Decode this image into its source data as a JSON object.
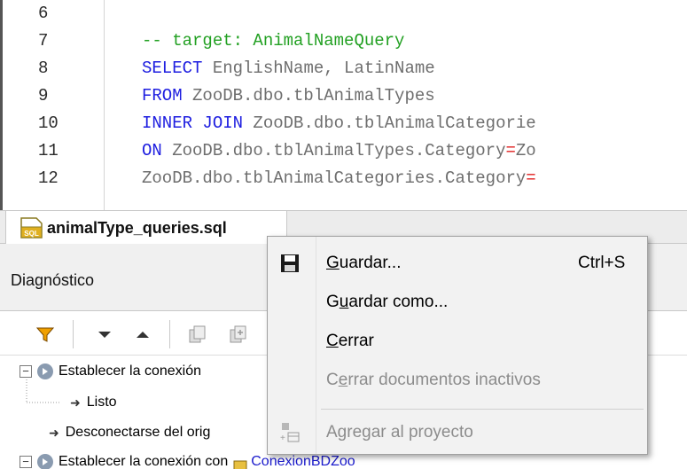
{
  "editor": {
    "lines": [
      {
        "num": "6",
        "tokens": []
      },
      {
        "num": "7",
        "tokens": [
          {
            "t": "-- target: AnimalNameQuery",
            "c": "cm"
          }
        ]
      },
      {
        "num": "8",
        "tokens": [
          {
            "t": "SELECT",
            "c": "kw"
          },
          {
            "t": " EnglishName, LatinName",
            "c": "id"
          }
        ]
      },
      {
        "num": "9",
        "tokens": [
          {
            "t": "FROM",
            "c": "kw"
          },
          {
            "t": " ZooDB.dbo.tblAnimalTypes",
            "c": "id"
          }
        ]
      },
      {
        "num": "10",
        "tokens": [
          {
            "t": "INNER JOIN",
            "c": "kw"
          },
          {
            "t": " ZooDB.dbo.tblAnimalCategorie",
            "c": "id"
          }
        ]
      },
      {
        "num": "11",
        "tokens": [
          {
            "t": "ON",
            "c": "kw"
          },
          {
            "t": " ZooDB.dbo.tblAnimalTypes.Category",
            "c": "id"
          },
          {
            "t": "=",
            "c": "op"
          },
          {
            "t": "Zo",
            "c": "id"
          }
        ]
      },
      {
        "num": "12",
        "tokens": [
          {
            "t": "ZooDB.dbo.tblAnimalCategories.Category",
            "c": "id"
          },
          {
            "t": "=",
            "c": "op"
          }
        ]
      }
    ]
  },
  "tab": {
    "filename": "animalType_queries.sql",
    "icon": "sql-file-icon"
  },
  "diagnostics": {
    "title": "Diagnóstico",
    "rows": {
      "r1": "Establecer la conexión",
      "r2": "Listo",
      "r3": "Desconectarse del orig",
      "r4_prefix": "Establecer la conexión con",
      "r4_link": "ConexionBDZoo"
    }
  },
  "context_menu": {
    "save_pre": "",
    "save_ul": "G",
    "save_post": "uardar...",
    "save_shortcut": "Ctrl+S",
    "saveas_pre": "G",
    "saveas_ul": "u",
    "saveas_post": "ardar como...",
    "close_pre": "",
    "close_ul": "C",
    "close_post": "errar",
    "close_inactive_pre": "C",
    "close_inactive_ul": "e",
    "close_inactive_post": "rrar documentos inactivos",
    "add_to_project": "Agregar al proyecto"
  },
  "colors": {
    "keyword": "#1e1ee0",
    "comment": "#22a022",
    "identifier": "#6e6e6e",
    "operator": "#e01e1e",
    "disabled": "#8c8c8c",
    "filter_icon": "#f0a000"
  }
}
